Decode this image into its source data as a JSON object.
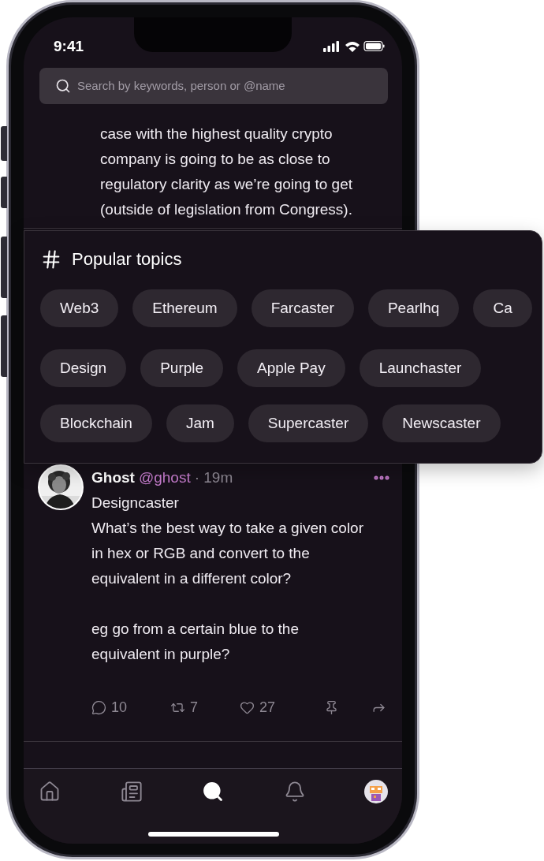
{
  "status_bar": {
    "time": "9:41"
  },
  "search": {
    "placeholder": "Search by keywords, person or @name"
  },
  "posts": [
    {
      "kind": "fragment",
      "body": "case with the highest quality crypto\ncompany is going to be as close to\nregulatory clarity as we’re going to get\n(outside of legislation from Congress)."
    },
    {
      "kind": "full",
      "name": "Ghost",
      "handle": "@ghost",
      "time": "· 19m",
      "body": "Designcaster\nWhat’s the best way to take a given color\nin hex or RGB and convert to the\nequivalent in a different color?\n\neg go from a certain blue to the\nequivalent in purple?",
      "actions": [
        {
          "kind": "reply",
          "count": "10"
        },
        {
          "kind": "recast",
          "count": "7"
        },
        {
          "kind": "like",
          "count": "27"
        },
        {
          "kind": "pin"
        },
        {
          "kind": "share"
        }
      ]
    }
  ],
  "topics": {
    "title": "Popular topics",
    "rows": [
      [
        "Web3",
        "Ethereum",
        "Farcaster",
        "Pearlhq",
        "Ca"
      ],
      [
        "Design",
        "Purple",
        "Apple Pay",
        "Launchaster"
      ],
      [
        "Blockchain",
        "Jam",
        "Supercaster",
        "Newscaster"
      ]
    ]
  },
  "tab_bar": [
    {
      "kind": "home",
      "selected": false
    },
    {
      "kind": "news",
      "selected": false
    },
    {
      "kind": "search",
      "selected": true
    },
    {
      "kind": "notifications",
      "selected": false
    },
    {
      "kind": "profile",
      "selected": false
    }
  ]
}
